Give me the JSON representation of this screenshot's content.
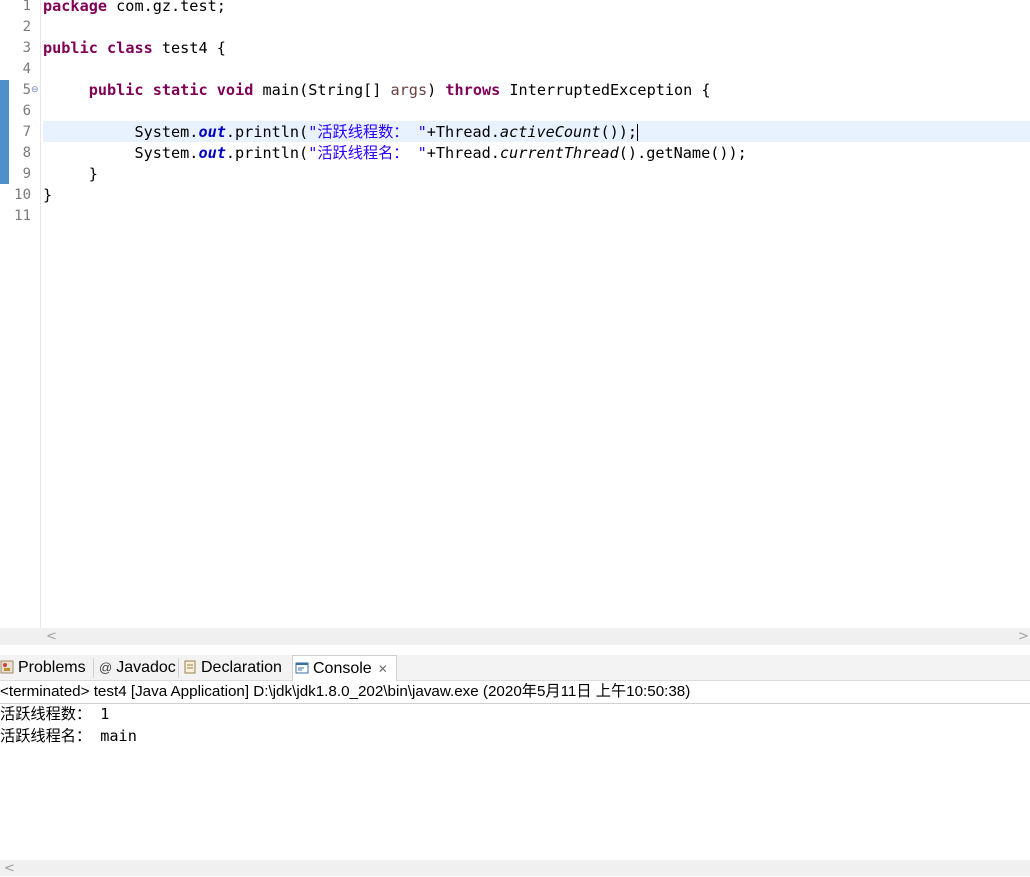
{
  "editor": {
    "line_numbers": [
      "1",
      "2",
      "3",
      "4",
      "5",
      "6",
      "7",
      "8",
      "9",
      "10",
      "11"
    ]
  },
  "code": {
    "l1_kw": "package",
    "l1_rest": " com.gz.test;",
    "l3_kw1": "public",
    "l3_kw2": "class",
    "l3_rest": " test4 {",
    "l5_kw1": "public",
    "l5_kw2": "static",
    "l5_kw3": "void",
    "l5_a": " main(String[] ",
    "l5_param": "args",
    "l5_b": ") ",
    "l5_kw4": "throws",
    "l5_c": " InterruptedException {",
    "l7_a": "System.",
    "l7_field": "out",
    "l7_b": ".println(",
    "l7_str": "\"活跃线程数： \"",
    "l7_c": "+Thread.",
    "l7_static": "activeCount",
    "l7_d": "());",
    "l8_a": "System.",
    "l8_field": "out",
    "l8_b": ".println(",
    "l8_str": "\"活跃线程名： \"",
    "l8_c": "+Thread.",
    "l8_static": "currentThread",
    "l8_d": "().getName());",
    "l9": "}",
    "l10": "}"
  },
  "tabs": {
    "problems": "Problems",
    "javadoc": "Javadoc",
    "declaration": "Declaration",
    "console": "Console",
    "javadoc_symbol": "@"
  },
  "console": {
    "header": "<terminated> test4 [Java Application] D:\\jdk\\jdk1.8.0_202\\bin\\javaw.exe (2020年5月11日 上午10:50:38)",
    "out1": "活跃线程数： 1",
    "out2": "活跃线程名： main"
  },
  "scroll": {
    "left": "<",
    "right": ">"
  },
  "colors": {
    "keyword": "#7f0055",
    "string": "#2a00ff",
    "field": "#0000c0",
    "current_line": "#e8f2fe"
  }
}
